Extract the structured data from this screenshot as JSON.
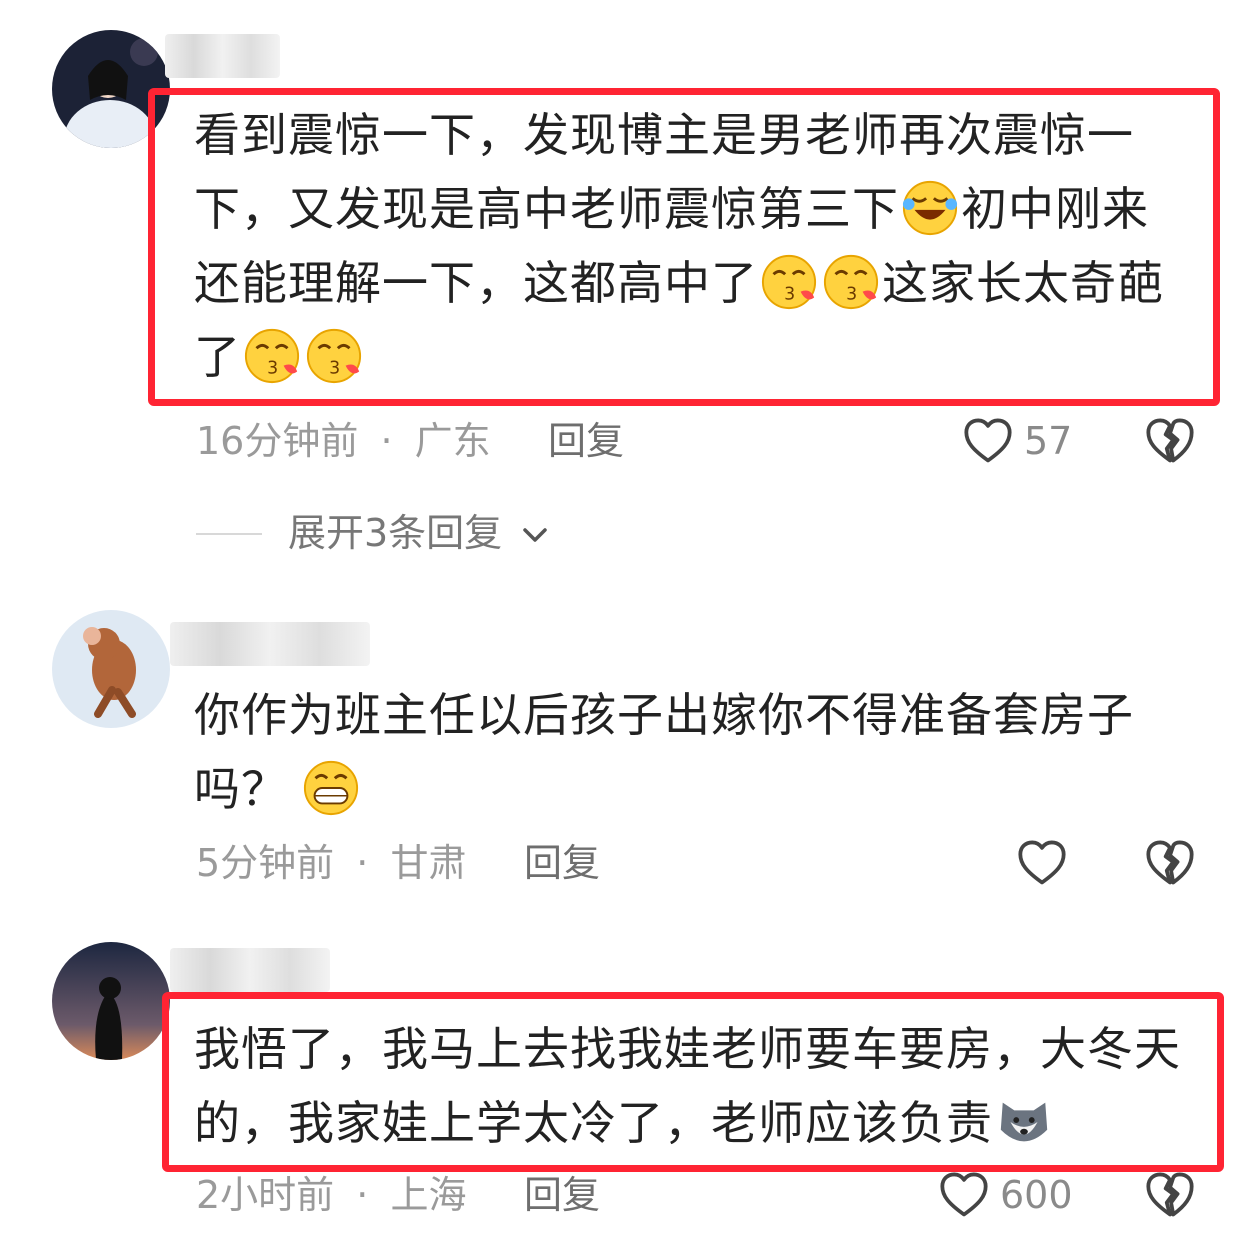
{
  "comments": [
    {
      "text": [
        "看到震惊一下，发现博主是男老师再次震惊一",
        "下，又发现是高中老师震惊第三下",
        "初中刚来",
        "还能理解一下，这都高中了",
        "这家长太奇葩",
        "了"
      ],
      "time": "16分钟前",
      "sep": "·",
      "location": "广东",
      "reply": "回复",
      "likes": "57",
      "expand": "展开3条回复"
    },
    {
      "text": [
        "你作为班主任以后孩子出嫁你不得准备套房子",
        "吗？"
      ],
      "time": "5分钟前",
      "sep": "·",
      "location": "甘肃",
      "reply": "回复",
      "likes": ""
    },
    {
      "text": [
        "我悟了，我马上去找我娃老师要车要房，大冬天",
        "的，我家娃上学太冷了，老师应该负责"
      ],
      "time": "2小时前",
      "sep": "·",
      "location": "上海",
      "reply": "回复",
      "likes": "600"
    }
  ],
  "icons": {
    "like": "heart-outline-icon",
    "dislike": "broken-heart-icon",
    "expand": "chevron-down-icon",
    "emoji_laugh_cry": "laugh-cry-emoji",
    "emoji_kiss": "kiss-emoji",
    "emoji_grin": "grin-emoji",
    "emoji_husky": "husky-emoji"
  },
  "colors": {
    "highlight": "#ff2433",
    "meta": "#9a9a9a",
    "text": "#222222"
  }
}
